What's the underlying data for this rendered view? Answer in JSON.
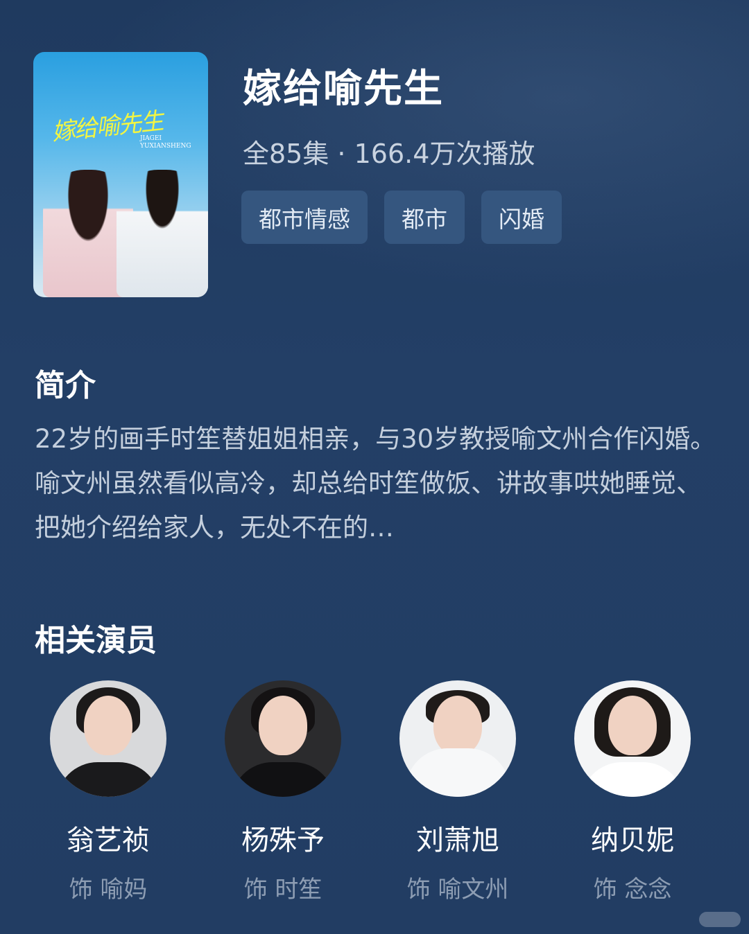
{
  "drama": {
    "title": "嫁给喻先生",
    "meta": "全85集 · 166.4万次播放",
    "poster_title": "嫁给喻先生",
    "poster_subtitle": "JIAGEI YUXIANSHENG",
    "tags": [
      "都市情感",
      "都市",
      "闪婚"
    ]
  },
  "intro": {
    "heading": "简介",
    "text": "22岁的画手时笙替姐姐相亲，与30岁教授喻文州合作闪婚。喻文州虽然看似高冷，却总给时笙做饭、讲故事哄她睡觉、把她介绍给家人，无处不在的…"
  },
  "cast": {
    "heading": "相关演员",
    "members": [
      {
        "name": "翁艺祯",
        "role": "饰 喻妈"
      },
      {
        "name": "杨殊予",
        "role": "饰 时笙"
      },
      {
        "name": "刘萧旭",
        "role": "饰 喻文州"
      },
      {
        "name": "纳贝妮",
        "role": "饰 念念"
      }
    ]
  },
  "colors": {
    "background": "#233f66",
    "tag_bg": "#35567f",
    "muted_text": "#8d9db3"
  }
}
